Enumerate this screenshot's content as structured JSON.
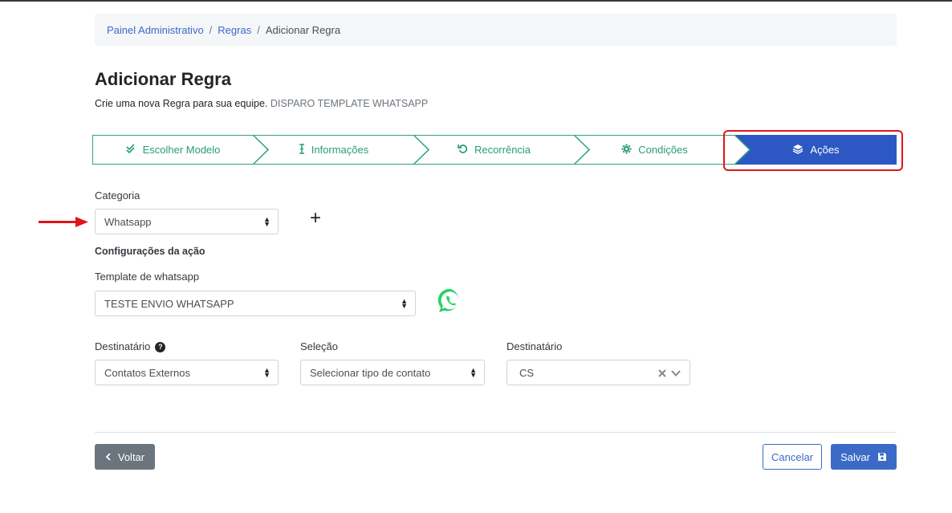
{
  "breadcrumb": {
    "items": [
      "Painel Administrativo",
      "Regras"
    ],
    "current": "Adicionar Regra"
  },
  "page": {
    "title": "Adicionar Regra",
    "subtitle": "Crie uma nova Regra para sua equipe.",
    "subtitle_tag": "DISPARO TEMPLATE WHATSAPP"
  },
  "steps": [
    {
      "label": "Escolher Modelo",
      "icon": "double-check-icon"
    },
    {
      "label": "Informações",
      "icon": "text-cursor-icon"
    },
    {
      "label": "Recorrência",
      "icon": "undo-icon"
    },
    {
      "label": "Condições",
      "icon": "gear-icon"
    },
    {
      "label": "Ações",
      "icon": "layers-icon",
      "active": true
    }
  ],
  "form": {
    "categoria_label": "Categoria",
    "categoria_value": "Whatsapp",
    "config_heading": "Configurações da ação",
    "template_label": "Template de whatsapp",
    "template_value": "TESTE ENVIO WHATSAPP",
    "destinatario_label": "Destinatário",
    "destinatario_value": "Contatos Externos",
    "selecao_label": "Seleção",
    "selecao_value": "Selecionar tipo de contato",
    "destinatario2_label": "Destinatário",
    "destinatario2_value": "CS"
  },
  "buttons": {
    "back": "Voltar",
    "cancel": "Cancelar",
    "save": "Salvar"
  },
  "colors": {
    "primary": "#3b6bc7",
    "step_green": "#2fa37a",
    "active_step": "#2d58c3",
    "highlight": "#e0151a",
    "whatsapp": "#25d366"
  }
}
